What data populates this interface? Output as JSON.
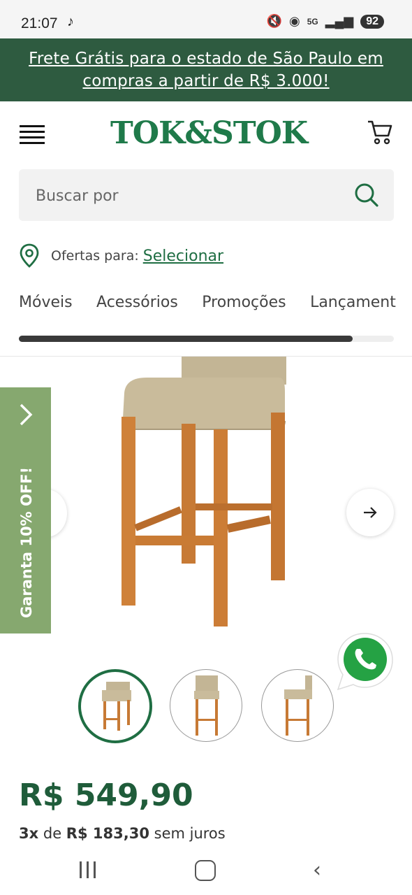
{
  "status_bar": {
    "time": "21:07",
    "battery": "92",
    "icons": [
      "tiktok-icon",
      "mute-icon",
      "hotspot-icon",
      "5g-icon",
      "signal-icon"
    ]
  },
  "promo_banner": {
    "text": "Frete Grátis para o estado de São Paulo em compras a partir de R$ 3.000!"
  },
  "header": {
    "logo": "TOK&STOK",
    "icons": [
      "menu-icon",
      "cart-icon"
    ]
  },
  "search": {
    "placeholder": "Buscar por"
  },
  "location": {
    "label": "Ofertas para:",
    "link": "Selecionar"
  },
  "categories": {
    "items": [
      "Móveis",
      "Acessórios",
      "Promoções",
      "Lançamentos"
    ],
    "scroll_progress": 0.89
  },
  "side_tab": {
    "label": "Garanta 10% OFF!"
  },
  "gallery": {
    "thumbnail_count": 3,
    "active_index": 0
  },
  "price": {
    "value": "R$ 549,90",
    "installments_count": "3x",
    "installments_connector": "de",
    "installments_value": "R$ 183,30",
    "installments_suffix": "sem juros"
  },
  "colors": {
    "brand_green": "#1f6e43",
    "promo_bg": "#2e5b40",
    "side_tab_bg": "#86a86f",
    "whatsapp_green": "#25a244"
  }
}
